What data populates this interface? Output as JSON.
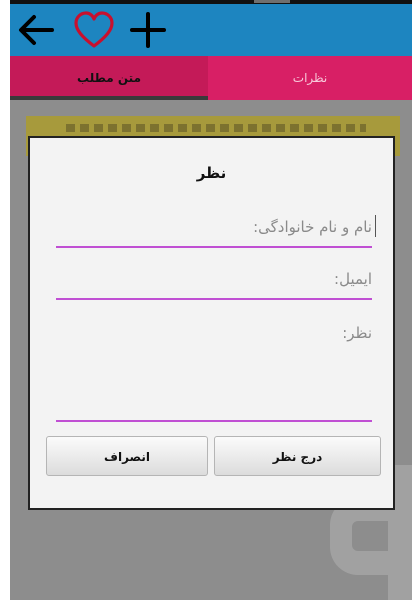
{
  "toolbar": {
    "back_icon": "arrow-left-icon",
    "favorite_icon": "heart-outline-icon",
    "add_icon": "plus-icon",
    "color": "#1d85c0"
  },
  "tabs": [
    {
      "label": "متن مطلب",
      "selected": true
    },
    {
      "label": "نظرات",
      "selected": false
    }
  ],
  "dialog": {
    "title": "نظر",
    "fields": {
      "name_placeholder": "نام و نام خانوادگی:",
      "email_placeholder": "ایمیل:",
      "comment_placeholder": "نظر:"
    },
    "buttons": {
      "cancel_label": "انصراف",
      "submit_label": "درج نظر"
    },
    "accent": "#c04fd3"
  },
  "colors": {
    "tab_bar": "#d81f65",
    "overlay": "#8d8d8d"
  }
}
